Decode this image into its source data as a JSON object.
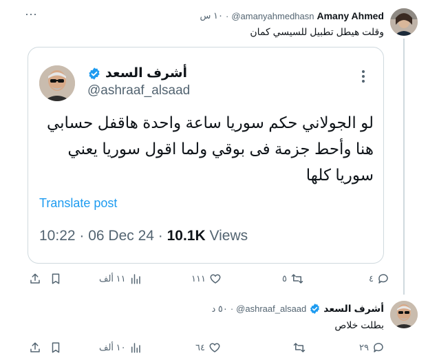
{
  "tweet1": {
    "name": "Amany Ahmed",
    "handle": "@amanyahmedhasn",
    "time": "١٠ س",
    "text": "وقلت هيطل تطبيل للسيسي كمان",
    "actions": {
      "reply": "٤",
      "retweet": "٥",
      "like": "١١١",
      "views": "١١ ألف"
    }
  },
  "quoted": {
    "name": "أشرف السعد",
    "handle": "@ashraaf_alsaad",
    "text_line1": "لو الجولاني حكم سوريا ساعة واحدة هاقفل حسابي",
    "text_line2": "هنا وأحط جزمة فى بوقي ولما اقول سوريا يعني",
    "text_line3": "سوريا كلها",
    "translate": "Translate post",
    "time": "10:22 · 06 Dec 24 · ",
    "views_count": "10.1K",
    "views_label": " Views"
  },
  "tweet2": {
    "name": "أشرف السعد",
    "handle": "@ashraaf_alsaad",
    "time": "٥٠ د",
    "text": "بطلت خلاص",
    "actions": {
      "reply": "٢٩",
      "retweet": "",
      "like": "٦٤",
      "views": "١٠ ألف"
    }
  },
  "colors": {
    "verified": "#1d9bf0",
    "link": "#1d9bf0",
    "muted": "#536471"
  }
}
